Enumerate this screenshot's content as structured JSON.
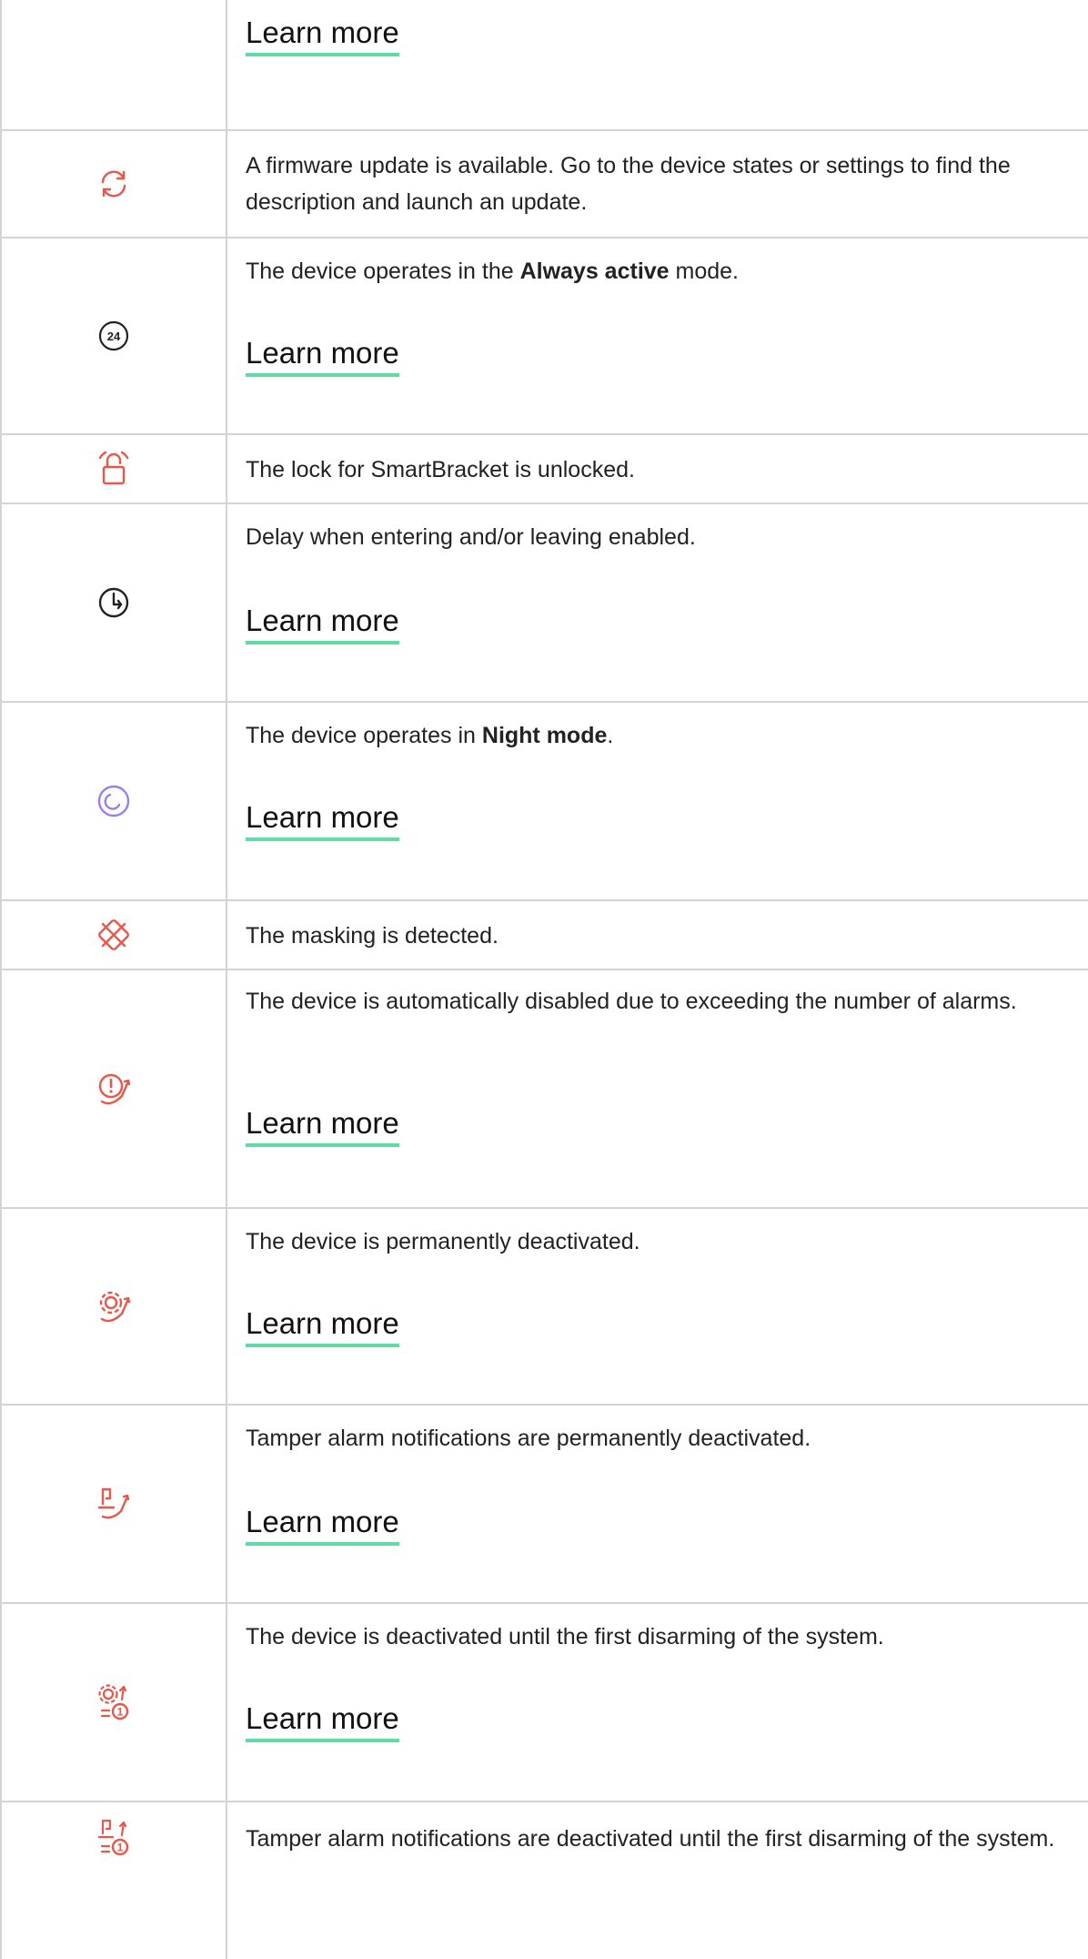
{
  "rows": [
    {
      "learn_more": "Learn more"
    },
    {
      "icon": "firmware-update-icon",
      "text": "A firmware update is available. Go to the device states or settings to find the description and launch an update."
    },
    {
      "icon": "always-active-24-icon",
      "icon_label": "24",
      "text_before": "The device operates in the ",
      "text_bold": "Always active",
      "text_after": " mode.",
      "learn_more": "Learn more"
    },
    {
      "icon": "unlocked-lock-icon",
      "text": "The lock for SmartBracket is unlocked."
    },
    {
      "icon": "delay-clock-icon",
      "text": "Delay when entering and/or leaving enabled.",
      "learn_more": "Learn more"
    },
    {
      "icon": "night-mode-icon",
      "text_before": "The device operates in ",
      "text_bold": "Night mode",
      "text_after": ".",
      "learn_more": "Learn more"
    },
    {
      "icon": "masking-icon",
      "text": "The masking is detected."
    },
    {
      "icon": "auto-disabled-alarms-icon",
      "text": "The device is automatically disabled due to exceeding the number of alarms.",
      "learn_more": "Learn more"
    },
    {
      "icon": "permanently-deactivated-gear-icon",
      "text": "The device is permanently deactivated.",
      "learn_more": "Learn more"
    },
    {
      "icon": "tamper-deactivated-icon",
      "text": "Tamper alarm notifications are permanently deactivated.",
      "learn_more": "Learn more"
    },
    {
      "icon": "deactivated-until-disarm-gear-icon",
      "icon_badge": "1",
      "text": "The device is deactivated until the first disarming of the system.",
      "learn_more": "Learn more"
    },
    {
      "icon": "tamper-deactivated-until-disarm-icon",
      "icon_badge": "1",
      "text": "Tamper alarm notifications are deactivated until the first disarming of the system."
    }
  ],
  "colors": {
    "icon_red": "#e8574a",
    "icon_purple": "#9b7cf5",
    "icon_dark": "#222222",
    "link_underline": "#5fdba6",
    "border": "#d3d3d3"
  }
}
